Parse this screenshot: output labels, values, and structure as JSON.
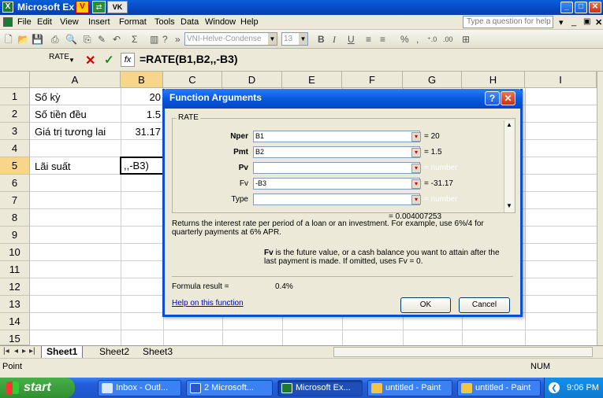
{
  "window": {
    "title": "Microsoft Ex",
    "badge_v": "V",
    "badge_vk": "VK"
  },
  "menu": {
    "items": [
      "File",
      "Edit",
      "View",
      "Insert",
      "Format",
      "Tools",
      "Data",
      "Window",
      "Help"
    ],
    "help_placeholder": "Type a question for help"
  },
  "toolbar": {
    "font_name": "VNI-Helve-Condense",
    "font_size": "13",
    "bold": "B",
    "italic": "I",
    "underline": "U",
    "percent": "%",
    "comma": ","
  },
  "formula_bar": {
    "name_box": "RATE",
    "cancel": "✕",
    "enter": "✓",
    "fx": "fx",
    "formula": "=RATE(B1,B2,,-B3)"
  },
  "grid": {
    "columns": [
      "A",
      "B",
      "C",
      "D",
      "E",
      "F",
      "G",
      "H",
      "I"
    ],
    "rows": [
      "1",
      "2",
      "3",
      "4",
      "5",
      "6",
      "7",
      "8",
      "9",
      "10",
      "11",
      "12",
      "13",
      "14",
      "15"
    ],
    "cells": {
      "A1": "Số kỳ",
      "B1": "20",
      "A2": "Số tiền đều",
      "B2": "1.5",
      "A3": "Giá trị tương lai",
      "B3": "31.17",
      "A5": "Lãi suất",
      "B5": ",,-B3)"
    }
  },
  "dialog": {
    "title": "Function Arguments",
    "group_label": "RATE",
    "args": [
      {
        "label": "Nper",
        "value": "B1",
        "result": "= 20",
        "bold": true
      },
      {
        "label": "Pmt",
        "value": "B2",
        "result": "= 1.5",
        "bold": true
      },
      {
        "label": "Pv",
        "value": "",
        "result": "= number",
        "bold": true
      },
      {
        "label": "Fv",
        "value": "-B3",
        "result": "= -31.17",
        "bold": false
      },
      {
        "label": "Type",
        "value": "",
        "result": "= number",
        "bold": false
      }
    ],
    "overall_result": "= 0.004007253",
    "description": "Returns the interest rate per period of a loan or an investment. For example, use 6%/4 for quarterly payments at 6% APR.",
    "arg_help_name": "Fv",
    "arg_help_text": "is the future value, or a cash balance you want to attain after the last payment is made. If omitted, uses Fv = 0.",
    "formula_result_label": "Formula result =",
    "formula_result_value": "0.4%",
    "help_link": "Help on this function",
    "ok": "OK",
    "cancel": "Cancel"
  },
  "sheets": {
    "tabs": [
      "Sheet1",
      "Sheet2",
      "Sheet3"
    ],
    "active": "Sheet1"
  },
  "status": {
    "mode": "Point",
    "num": "NUM"
  },
  "taskbar": {
    "start": "start",
    "tasks": [
      "Inbox - Outl...",
      "2 Microsoft...",
      "Microsoft Ex...",
      "untitled - Paint",
      "untitled - Paint"
    ],
    "clock": "9:06 PM"
  }
}
